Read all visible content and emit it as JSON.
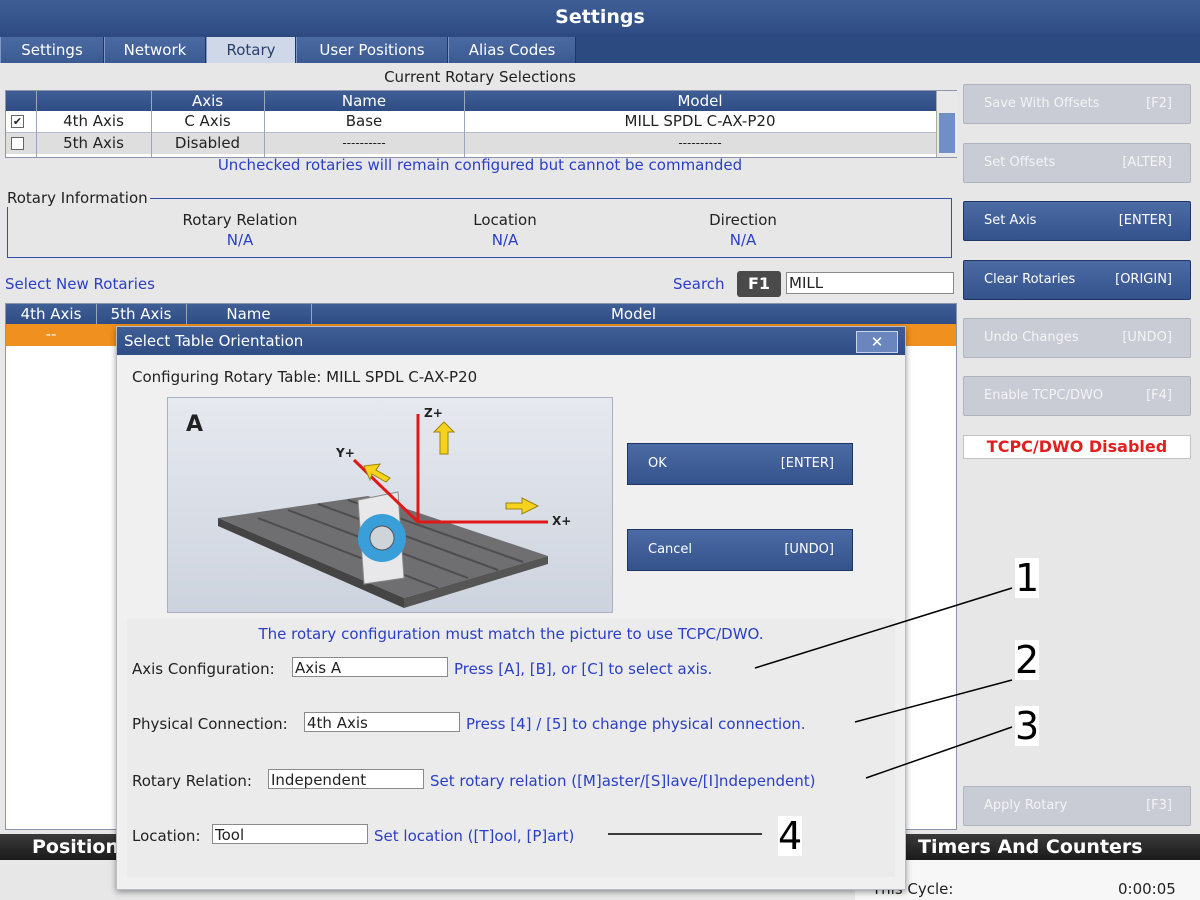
{
  "title": "Settings",
  "tabs": [
    "Settings",
    "Network",
    "Rotary",
    "User Positions",
    "Alias Codes"
  ],
  "current": {
    "heading": "Current Rotary Selections",
    "columns": [
      "Axis",
      "Name",
      "Model"
    ],
    "rows": [
      {
        "checked": true,
        "slot": "4th Axis",
        "axis": "C Axis",
        "name": "Base",
        "model": "MILL SPDL C-AX-P20"
      },
      {
        "checked": false,
        "slot": "5th Axis",
        "axis": "Disabled",
        "name": "----------",
        "model": "----------"
      }
    ],
    "note": "Unchecked rotaries will remain configured but cannot be commanded"
  },
  "info": {
    "legend": "Rotary Information",
    "relation_label": "Rotary Relation",
    "relation_value": "N/A",
    "location_label": "Location",
    "location_value": "N/A",
    "direction_label": "Direction",
    "direction_value": "N/A"
  },
  "select": {
    "label": "Select New Rotaries",
    "search_label": "Search",
    "search_key": "F1",
    "search_value": "MILL",
    "columns": [
      "4th Axis",
      "5th Axis",
      "Name",
      "Model"
    ],
    "row_first": "--"
  },
  "buttons": [
    {
      "label": "Save With Offsets",
      "key": "[F2]"
    },
    {
      "label": "Set Offsets",
      "key": "[ALTER]"
    },
    {
      "label": "Set Axis",
      "key": "[ENTER]"
    },
    {
      "label": "Clear Rotaries",
      "key": "[ORIGIN]"
    },
    {
      "label": "Undo Changes",
      "key": "[UNDO]"
    },
    {
      "label": "Enable TCPC/DWO",
      "key": "[F4]"
    },
    {
      "label": "Apply Rotary",
      "key": "[F3]"
    }
  ],
  "tcpc_status": "TCPC/DWO Disabled",
  "dialog": {
    "title": "Select Table Orientation",
    "close": "✕",
    "configuring": "Configuring Rotary Table: MILL SPDL C-AX-P20",
    "picture_letter": "A",
    "axis_z": "Z+",
    "axis_y": "Y+",
    "axis_x": "X+",
    "ok_label": "OK",
    "ok_key": "[ENTER]",
    "cancel_label": "Cancel",
    "cancel_key": "[UNDO]",
    "must_match": "The rotary configuration must match the picture to use TCPC/DWO.",
    "fields": [
      {
        "label": "Axis Configuration:",
        "value": "Axis A",
        "hint": "Press [A], [B], or [C] to select axis."
      },
      {
        "label": "Physical Connection:",
        "value": "4th Axis",
        "hint": "Press [4] / [5] to change physical connection."
      },
      {
        "label": "Rotary Relation:",
        "value": "Independent",
        "hint": "Set rotary relation ([M]aster/[S]lave/[I]ndependent)"
      },
      {
        "label": "Location:",
        "value": "Tool",
        "hint": "Set location ([T]ool, [P]art)"
      }
    ]
  },
  "callouts": [
    "1",
    "2",
    "3",
    "4"
  ],
  "bottom": {
    "positions": "Positions",
    "timers": "Timers And Counters",
    "cycle_label": "This Cycle:",
    "cycle_value": "0:00:05"
  }
}
